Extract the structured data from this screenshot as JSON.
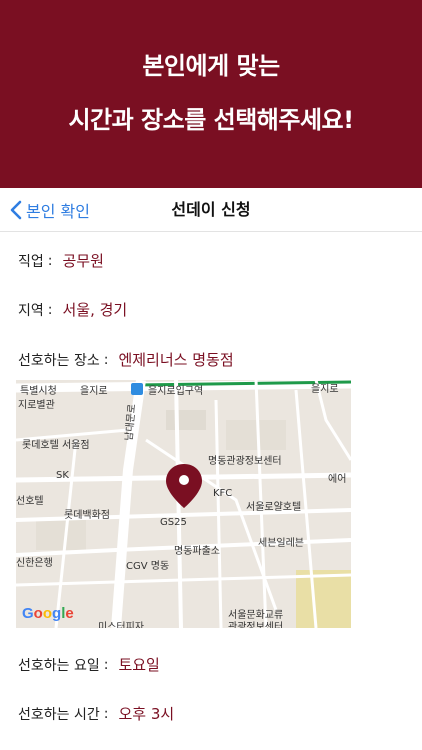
{
  "promo": {
    "line1": "본인에게 맞는",
    "line2": "시간과 장소를 선택해주세요!"
  },
  "navbar": {
    "back_label": "본인 확인",
    "title": "선데이 신청"
  },
  "fields": {
    "job": {
      "label": "직업",
      "value": "공무원"
    },
    "region": {
      "label": "지역",
      "value": "서울, 경기"
    },
    "place": {
      "label": "선호하는 장소",
      "value": "엔제리너스 명동점"
    },
    "day": {
      "label": "선호하는 요일",
      "value": "토요일"
    },
    "time": {
      "label": "선호하는 시간",
      "value": "오후 3시"
    }
  },
  "map": {
    "labels": {
      "top_left": "특별시청",
      "top_street": "을지로",
      "station": "을지로입구역",
      "top_right": "을지로",
      "left_hall": "지로별관",
      "lotte_hotel": "롯데호텔 서울점",
      "sk": "SK",
      "street_v": "남대문로",
      "tourism": "명동관광정보센터",
      "kfc": "KFC",
      "seoul_hotel": "서울로얄호텔",
      "air": "에어",
      "hotel_left": "선호텔",
      "lotte_dept": "롯데백화점",
      "gs25": "GS25",
      "sebang": "세븐일레븐",
      "shinhan": "신한은행",
      "police": "명동파출소",
      "cgv": "CGV 명동",
      "pizza": "미스터피자",
      "culture1": "서울문화교류",
      "culture2": "관광정보센터"
    },
    "google": [
      "G",
      "o",
      "o",
      "g",
      "l",
      "e"
    ],
    "google_colors": [
      "#4285f4",
      "#ea4335",
      "#fbbc05",
      "#4285f4",
      "#34a853",
      "#ea4335"
    ]
  }
}
